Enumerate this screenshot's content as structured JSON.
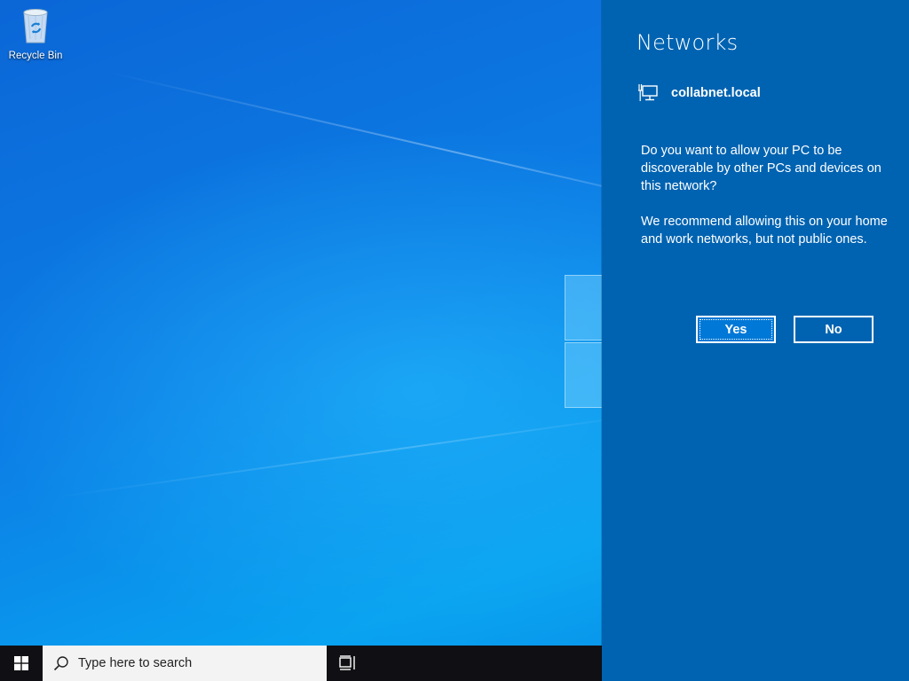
{
  "desktop": {
    "icons": [
      {
        "label": "Recycle Bin",
        "icon": "recycle-bin-icon"
      }
    ]
  },
  "taskbar": {
    "start_icon": "windows-logo-icon",
    "search": {
      "placeholder": "Type here to search",
      "icon": "search-icon"
    },
    "task_view_icon": "task-view-icon"
  },
  "flyout": {
    "title": "Networks",
    "network": {
      "name": "collabnet.local",
      "icon": "wired-network-icon"
    },
    "question": "Do you want to allow your PC to be discoverable by other PCs and devices on this network?",
    "recommendation": "We recommend allowing this on your home and work networks, but not public ones.",
    "yes_label": "Yes",
    "no_label": "No"
  },
  "colors": {
    "flyout_bg": "#0063b1",
    "taskbar_bg": "#101014",
    "yes_button_bg": "#0078d7"
  }
}
